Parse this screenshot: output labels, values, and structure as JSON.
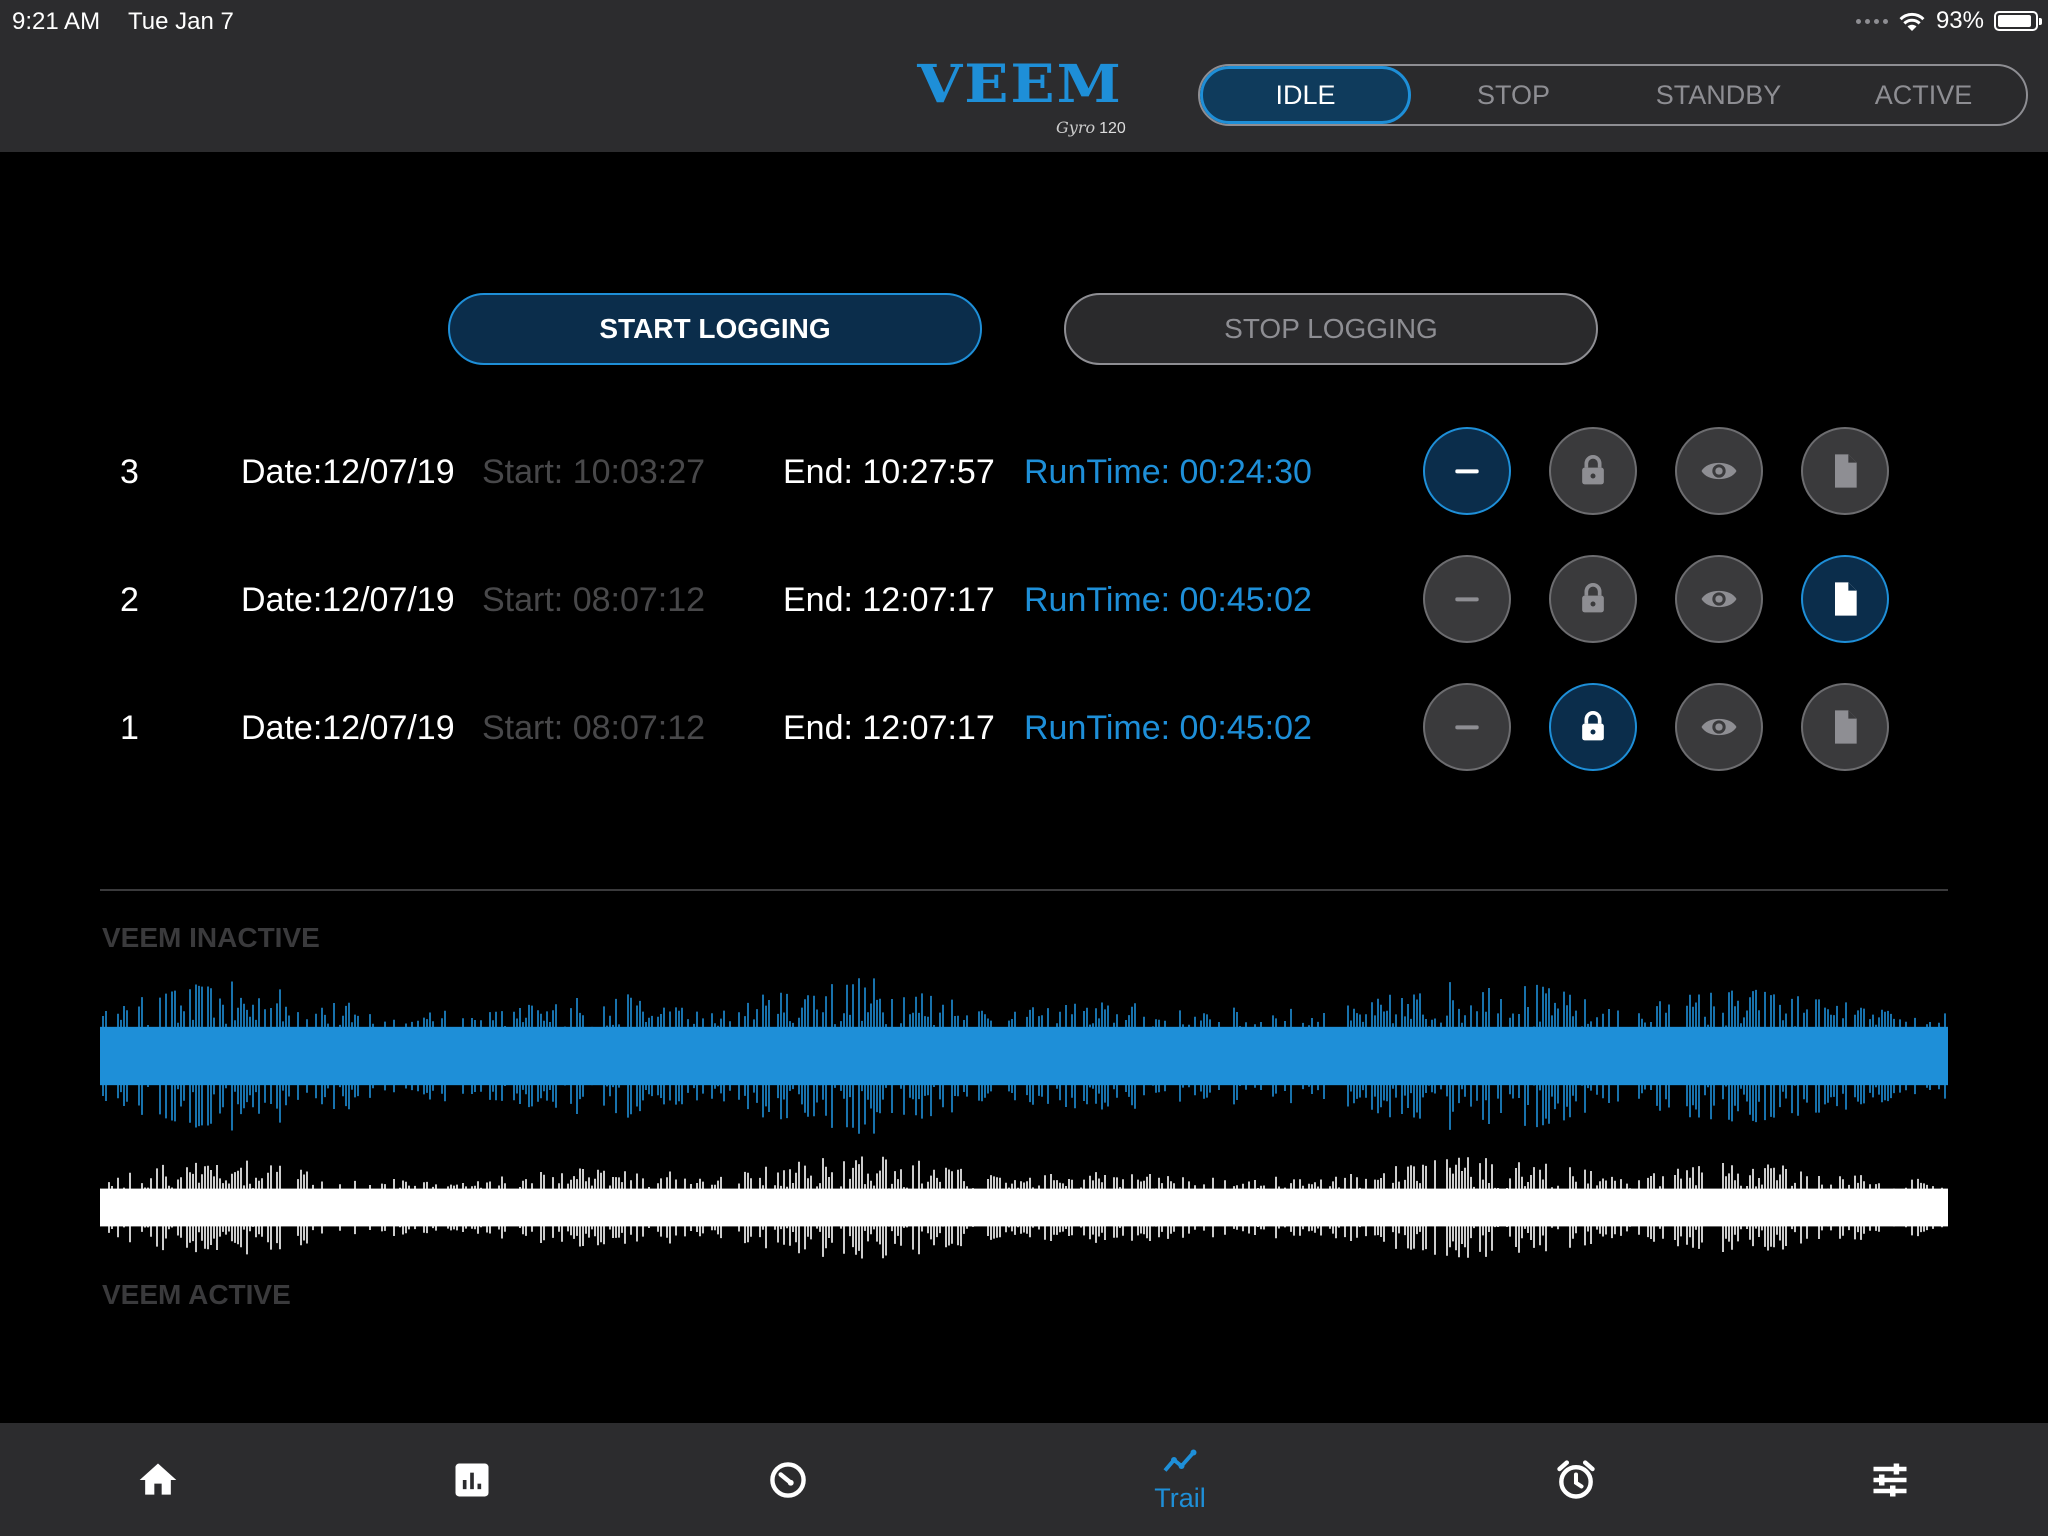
{
  "status_bar": {
    "time": "9:21 AM",
    "date": "Tue Jan 7",
    "battery": "93%",
    "battery_level": 0.93
  },
  "header": {
    "logo_text": "VEEM",
    "logo_script": "Gyro",
    "logo_model": "120",
    "modes": [
      {
        "label": "IDLE",
        "active": true
      },
      {
        "label": "STOP",
        "active": false
      },
      {
        "label": "STANDBY",
        "active": false
      },
      {
        "label": "ACTIVE",
        "active": false
      }
    ]
  },
  "logging": {
    "start_label": "START LOGGING",
    "stop_label": "STOP LOGGING"
  },
  "logs": [
    {
      "id": "3",
      "date": "Date:12/07/19",
      "start": "Start: 10:03:27",
      "end": "End: 10:27:57",
      "runtime": "RunTime: 00:24:30",
      "active": "minus"
    },
    {
      "id": "2",
      "date": "Date:12/07/19",
      "start": "Start: 08:07:12",
      "end": "End: 12:07:17",
      "runtime": "RunTime: 00:45:02",
      "active": "doc"
    },
    {
      "id": "1",
      "date": "Date:12/07/19",
      "start": "Start: 08:07:12",
      "end": "End: 12:07:17",
      "runtime": "RunTime: 00:45:02",
      "active": "lock"
    }
  ],
  "waveforms": {
    "inactive_label": "VEEM INACTIVE",
    "active_label": "VEEM ACTIVE",
    "inactive_color": "#1e8fd8",
    "active_color": "#ffffff"
  },
  "tabbar": {
    "items": [
      {
        "icon": "home-icon",
        "label": "",
        "active": false
      },
      {
        "icon": "bar-chart-icon",
        "label": "",
        "active": false
      },
      {
        "icon": "gauge-icon",
        "label": "",
        "active": false
      },
      {
        "icon": "trail-icon",
        "label": "Trail",
        "active": true
      },
      {
        "icon": "alarm-clock-icon",
        "label": "",
        "active": false
      },
      {
        "icon": "sliders-icon",
        "label": "",
        "active": false
      }
    ]
  },
  "colors": {
    "accent": "#1e8fd8",
    "accent_dark": "#0b2d4b",
    "muted": "#8e8e93",
    "panel": "#2c2c2e"
  }
}
